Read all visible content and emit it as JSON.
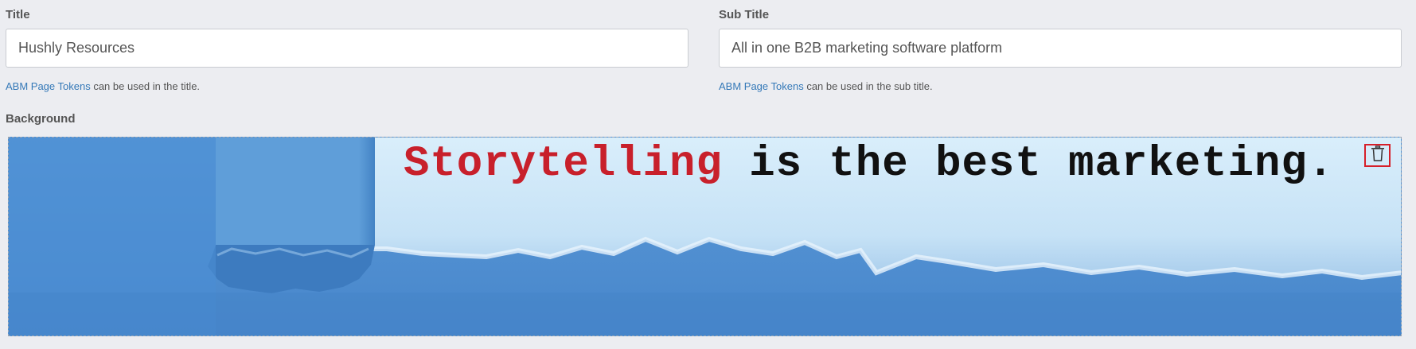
{
  "title_field": {
    "label": "Title",
    "value": "Hushly Resources",
    "help_link": "ABM Page Tokens",
    "help_text": " can be used in the title."
  },
  "subtitle_field": {
    "label": "Sub Title",
    "value": "All in one B2B marketing software platform",
    "help_link": "ABM Page Tokens",
    "help_text": " can be used in the sub title."
  },
  "background_field": {
    "label": "Background",
    "image_text_accent": "Storytelling",
    "image_text_rest": " is the best marketing.",
    "delete_icon": "trash-icon",
    "accent_color": "#c8202b",
    "paper_color": "#4d90d4"
  }
}
